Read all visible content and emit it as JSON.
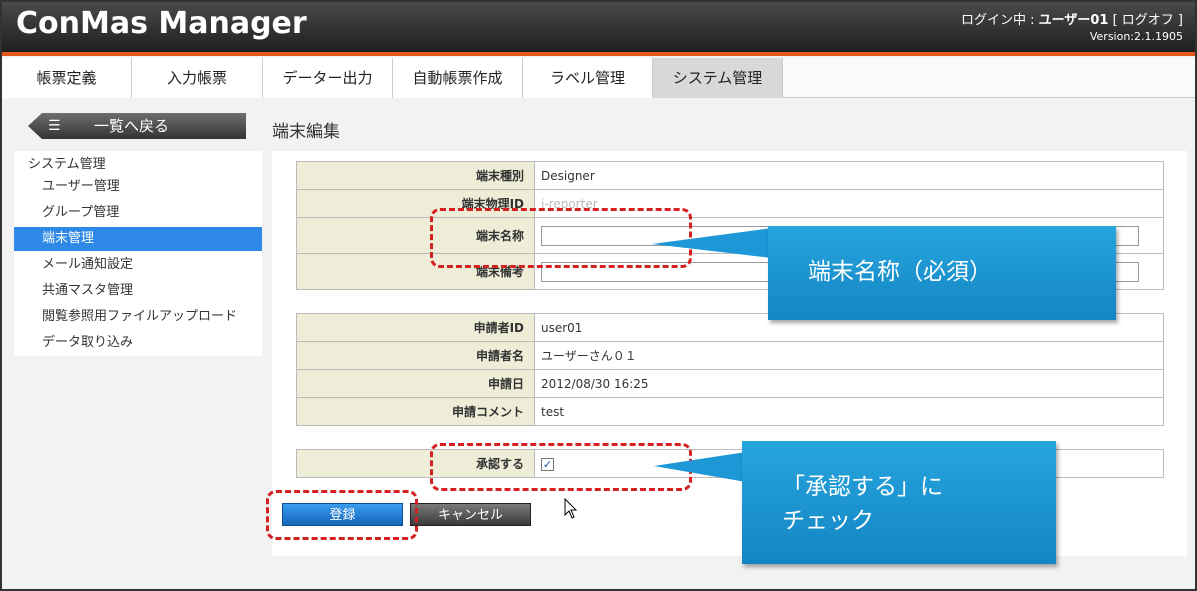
{
  "header": {
    "app_title": "ConMas Manager",
    "login_prefix": "ログイン中 : ",
    "user": "ユーザー01",
    "logout": "[ ログオフ ]",
    "version": "Version:2.1.1905"
  },
  "tabs": [
    {
      "label": "帳票定義"
    },
    {
      "label": "入力帳票"
    },
    {
      "label": "データー出力"
    },
    {
      "label": "自動帳票作成"
    },
    {
      "label": "ラベル管理"
    },
    {
      "label": "システム管理"
    }
  ],
  "back_button": {
    "icon": "list-icon",
    "label": "一覧へ戻る"
  },
  "page_title": "端末編集",
  "sidebar": {
    "heading": "システム管理",
    "items": [
      {
        "label": "ユーザー管理"
      },
      {
        "label": "グループ管理"
      },
      {
        "label": "端末管理"
      },
      {
        "label": "メール通知設定"
      },
      {
        "label": "共通マスタ管理"
      },
      {
        "label": "閲覧参照用ファイルアップロード"
      },
      {
        "label": "データ取り込み"
      }
    ]
  },
  "device": {
    "type_label": "端末種別",
    "type_value": "Designer",
    "physical_id_label": "端末物理ID",
    "physical_id_value": "i-reporter",
    "name_label": "端末名称",
    "name_value": "",
    "remarks_label": "端末備考",
    "remarks_value": ""
  },
  "request": {
    "applicant_id_label": "申請者ID",
    "applicant_id_value": "user01",
    "applicant_name_label": "申請者名",
    "applicant_name_value": "ユーザーさん０１",
    "date_label": "申請日",
    "date_value": "2012/08/30 16:25",
    "comment_label": "申請コメント",
    "comment_value": "test"
  },
  "approve": {
    "label": "承認する",
    "checked": true,
    "check_mark": "✓"
  },
  "buttons": {
    "register": "登録",
    "cancel": "キャンセル"
  },
  "annotations": {
    "callout1": "端末名称（必須）",
    "callout2_line1": "「承認する」に",
    "callout2_line2": "チェック"
  },
  "colors": {
    "accent_orange": "#e55a1c",
    "active_blue": "#2e8ae6",
    "annotation_red": "#d42020",
    "callout_blue": "#1e97d6"
  }
}
